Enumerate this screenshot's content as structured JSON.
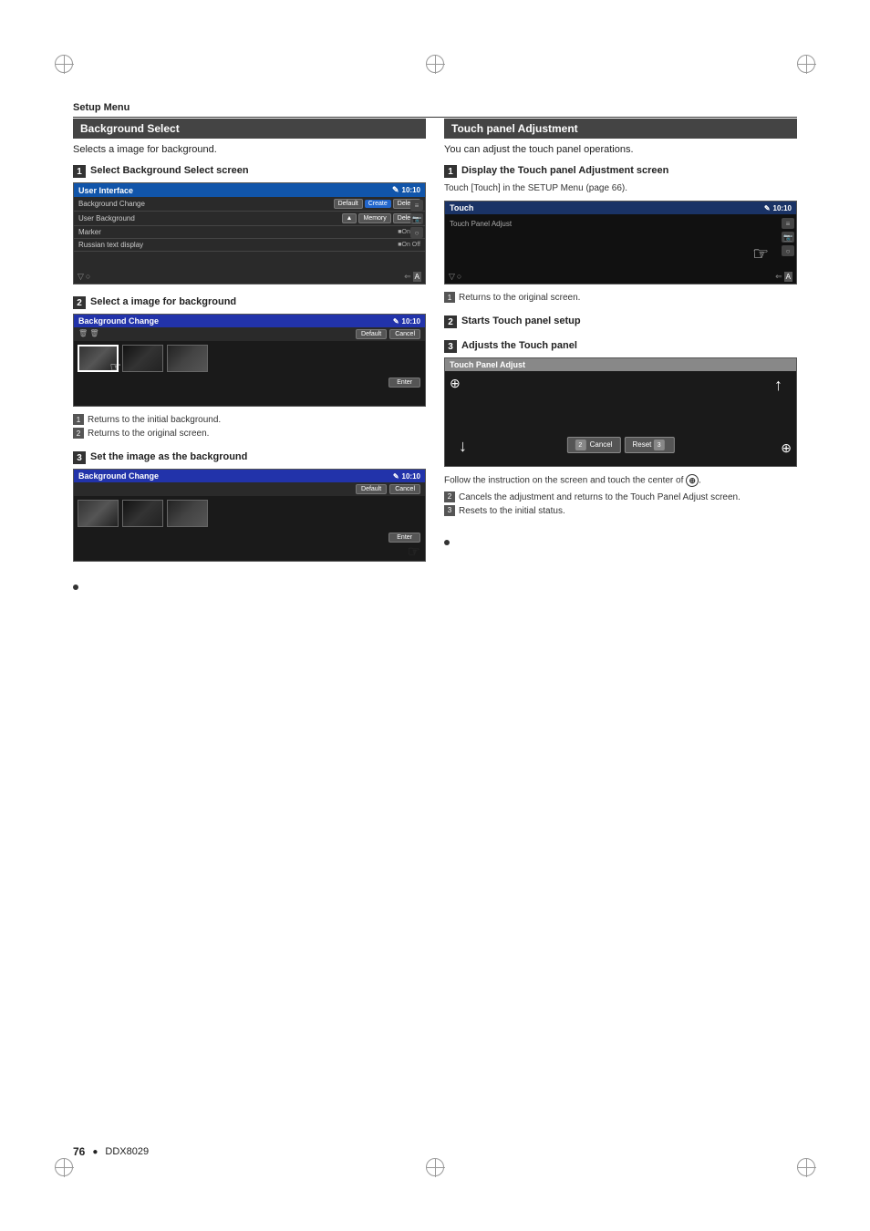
{
  "page": {
    "header": "Setup Menu",
    "footer_num": "76",
    "footer_model": "DDX8029"
  },
  "left_section": {
    "title": "Background Select",
    "intro": "Selects a image for background.",
    "step1": {
      "num": "1",
      "label": "Select Background Select screen",
      "screen_title": "User Interface",
      "screen_icon": "⊞",
      "time": "10:10",
      "rows": [
        {
          "label": "Background Change",
          "btn1": "Default",
          "btn2": "Create",
          "btn3": "Delete"
        },
        {
          "label": "User Background",
          "btn1": "▲",
          "btn2": "Memory",
          "btn3": ""
        },
        {
          "label": "Marker",
          "toggle": "On  Off"
        },
        {
          "label": "Russian text display",
          "toggle": "On  Off"
        }
      ]
    },
    "step2": {
      "num": "2",
      "label": "Select a image for background",
      "screen_title": "Background Change",
      "time": "10:10",
      "btn_default": "Default",
      "btn_cancel": "Cancel",
      "btn_enter": "Enter",
      "notes": [
        {
          "num": "1",
          "text": "Returns to the initial background."
        },
        {
          "num": "2",
          "text": "Returns to the original screen."
        }
      ]
    },
    "step3": {
      "num": "3",
      "label": "Set the image as the background",
      "screen_title": "Background Change",
      "time": "10:10",
      "btn_default": "Default",
      "btn_cancel": "Cancel",
      "btn_enter": "Enter"
    }
  },
  "right_section": {
    "title": "Touch panel Adjustment",
    "intro": "You can adjust the touch panel operations.",
    "step1": {
      "num": "1",
      "label": "Display the Touch panel Adjustment screen",
      "sub": "Touch [Touch] in the SETUP Menu (page 66).",
      "screen_title": "Touch",
      "screen_sub": "Touch Panel Adjust",
      "time": "10:10",
      "note1": "Returns to the original screen."
    },
    "step2": {
      "num": "2",
      "label": "Starts Touch panel setup"
    },
    "step3": {
      "num": "3",
      "label": "Adjusts the Touch panel",
      "screen_title": "Touch Panel Adjust",
      "btn_cancel": "Cancel",
      "btn_reset": "Reset",
      "notes": [
        {
          "text": "Follow the instruction on the screen and touch the center of"
        },
        {
          "num": "2",
          "text": "Cancels the adjustment and returns to the Touch Panel Adjust screen."
        },
        {
          "num": "3",
          "text": "Resets to the initial status."
        }
      ]
    }
  }
}
